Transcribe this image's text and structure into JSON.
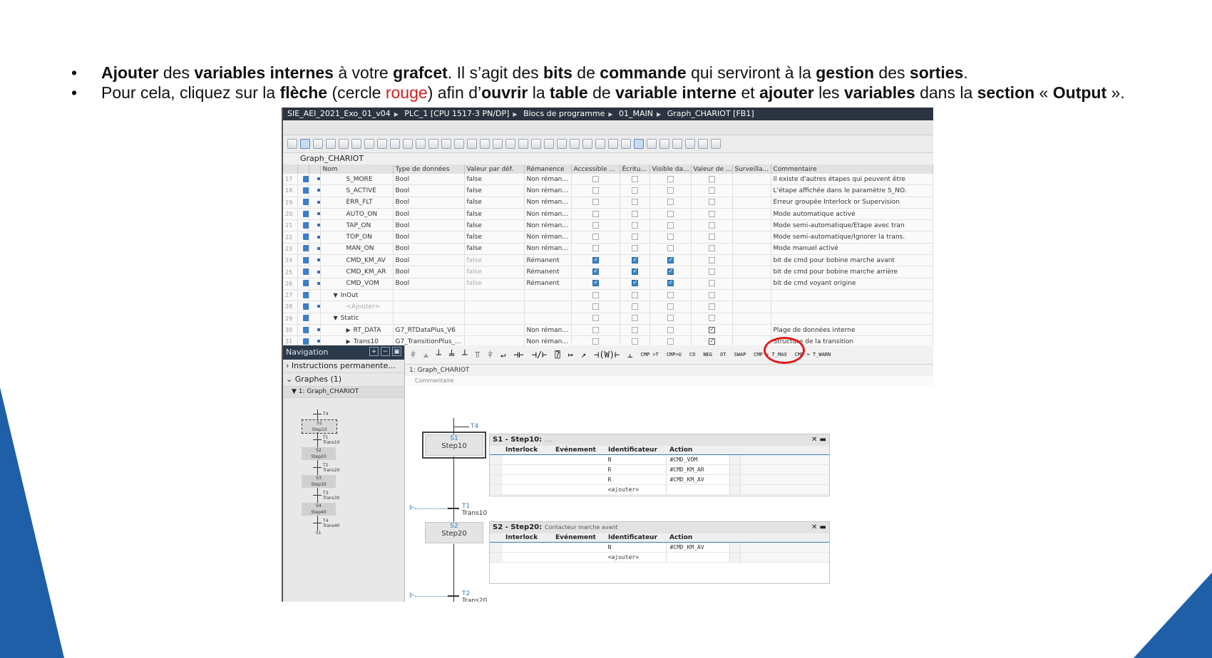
{
  "slide": {
    "bullet1": {
      "parts": [
        "Ajouter",
        " des ",
        "variables internes",
        " à votre ",
        "grafcet",
        ". Il s’agit des ",
        "bits",
        " de ",
        "commande",
        " qui serviront à la ",
        "gestion",
        " des ",
        "sorties",
        "."
      ]
    },
    "bullet2": {
      "parts": [
        "Pour cela, cliquez sur la ",
        "flèche",
        " (cercle ",
        "rouge",
        ") afin d’",
        "ouvrir",
        " la ",
        "table",
        " de ",
        "variable interne",
        " et ",
        "ajouter",
        " les ",
        "variables",
        " dans la ",
        "section",
        " « ",
        "Output",
        " »."
      ]
    },
    "colors": {
      "highlight": "#d21f1f",
      "deco_blue": "#1f5fa8"
    }
  },
  "breadcrumb": [
    "SIE_AEI_2021_Exo_01_v04",
    "PLC_1 [CPU 1517-3 PN/DP]",
    "Blocs de programme",
    "01_MAIN",
    "Graph_CHARIOT [FB1]"
  ],
  "block_name": "Graph_CHARIOT",
  "table": {
    "headers": [
      "Nom",
      "Type de données",
      "Valeur par déf.",
      "Rémanence",
      "Accessible ...",
      "Écritu...",
      "Visible da...",
      "Valeur de ...",
      "Surveilla...",
      "Commentaire"
    ],
    "rows": [
      {
        "n": "17",
        "name": "S_MORE",
        "type": "Bool",
        "def": "false",
        "rem": "Non réman...",
        "comment": "Il existe d'autres étapes qui peuvent être"
      },
      {
        "n": "18",
        "name": "S_ACTIVE",
        "type": "Bool",
        "def": "false",
        "rem": "Non réman...",
        "comment": "L'étape affichée dans le paramètre S_NO."
      },
      {
        "n": "19",
        "name": "ERR_FLT",
        "type": "Bool",
        "def": "false",
        "rem": "Non réman...",
        "comment": "Erreur groupée Interlock or Supervision"
      },
      {
        "n": "20",
        "name": "AUTO_ON",
        "type": "Bool",
        "def": "false",
        "rem": "Non réman...",
        "comment": "Mode automatique activé"
      },
      {
        "n": "21",
        "name": "TAP_ON",
        "type": "Bool",
        "def": "false",
        "rem": "Non réman...",
        "comment": "Mode semi-automatique/Etape avec tran"
      },
      {
        "n": "22",
        "name": "TOP_ON",
        "type": "Bool",
        "def": "false",
        "rem": "Non réman...",
        "comment": "Mode semi-automatique/Ignorer la trans."
      },
      {
        "n": "23",
        "name": "MAN_ON",
        "type": "Bool",
        "def": "false",
        "rem": "Non réman...",
        "comment": "Mode manuel activé"
      },
      {
        "n": "24",
        "name": "CMD_KM_AV",
        "type": "Bool",
        "def": "false",
        "rem": "Rémanent",
        "comment": "bit de cmd pour bobine marche avant"
      },
      {
        "n": "25",
        "name": "CMD_KM_AR",
        "type": "Bool",
        "def": "false",
        "rem": "Rémanent",
        "comment": "bit de cmd pour bobine marche arrière"
      },
      {
        "n": "26",
        "name": "CMD_VOM",
        "type": "Bool",
        "def": "false",
        "rem": "Rémanent",
        "comment": "bit de cmd voyant origine"
      },
      {
        "n": "27",
        "name": "InOut",
        "type": "",
        "def": "",
        "rem": "",
        "comment": ""
      },
      {
        "n": "28",
        "name": "<Ajouter>",
        "type": "",
        "def": "",
        "rem": "",
        "comment": ""
      },
      {
        "n": "29",
        "name": "Static",
        "type": "",
        "def": "",
        "rem": "",
        "comment": ""
      },
      {
        "n": "30",
        "name": "RT_DATA",
        "type": "G7_RTDataPlus_V6",
        "def": "",
        "rem": "Non réman...",
        "comment": "Plage de données interne"
      },
      {
        "n": "31",
        "name": "Trans10",
        "type": "G7_TransitionPlus_...",
        "def": "",
        "rem": "Non réman...",
        "comment": "Structure de la transition"
      }
    ]
  },
  "navigation": {
    "title": "Navigation",
    "items": [
      "Instructions permanente...",
      "Graphes (1)",
      "1: Graph_CHARIOT"
    ],
    "mini": {
      "steps": [
        {
          "s": "S1",
          "name": "Step10",
          "t": "T1",
          "trans": "Trans10"
        },
        {
          "s": "S2",
          "name": "Step20",
          "t": "T2",
          "trans": "Trans20"
        },
        {
          "s": "S3",
          "name": "Step30",
          "t": "T3",
          "trans": "Trans30"
        },
        {
          "s": "S4",
          "name": "Step40",
          "t": "T4",
          "trans": "Trans40"
        }
      ],
      "top_t": "T4",
      "end": "S1"
    }
  },
  "ladder_toolbar": [
    "CMP >T",
    "CMP>U",
    "CO",
    "NEG",
    "OT",
    "SWAP",
    "CMP > T_MAX",
    "CMP > T_WARN"
  ],
  "graph": {
    "title": "1:  Graph_CHARIOT",
    "comment": "Commentaire",
    "top_transition": "T4",
    "steps": [
      {
        "s": "S1",
        "name": "Step10",
        "panel_title": "S1 - Step10:",
        "panel_comment": "....",
        "t": "T1",
        "trans": "Trans10",
        "actions": [
          {
            "ident": "N",
            "action": "#CMD_VOM"
          },
          {
            "ident": "R",
            "action": "#CMD_KM_AR"
          },
          {
            "ident": "R",
            "action": "#CMD_KM_AV"
          },
          {
            "ident": "<ajouter>",
            "action": ""
          }
        ]
      },
      {
        "s": "S2",
        "name": "Step20",
        "panel_title": "S2 - Step20:",
        "panel_comment": "Contacteur marche avant",
        "t": "T2",
        "trans": "Trans20",
        "actions": [
          {
            "ident": "N",
            "action": "#CMD_KM_AV"
          },
          {
            "ident": "<ajouter>",
            "action": ""
          }
        ]
      }
    ],
    "panel_cols": [
      "Interlock",
      "Evénement",
      "Identificateur",
      "Action"
    ]
  }
}
